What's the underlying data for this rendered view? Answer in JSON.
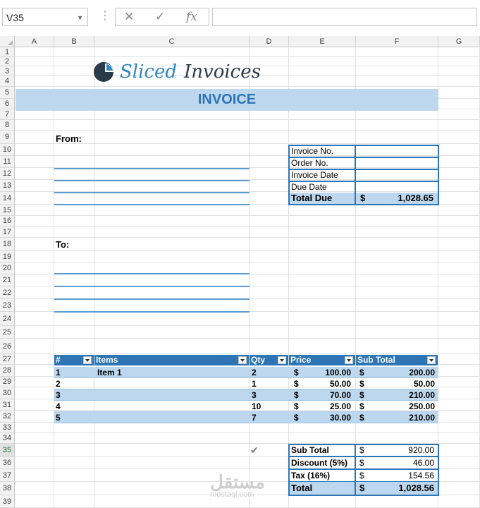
{
  "namebox": {
    "value": "V35"
  },
  "formula_bar": {
    "value": ""
  },
  "columns": [
    "A",
    "B",
    "C",
    "D",
    "E",
    "F",
    "G"
  ],
  "rows": [
    "1",
    "2",
    "3",
    "4",
    "5",
    "6",
    "7",
    "8",
    "9",
    "10",
    "11",
    "12",
    "13",
    "14",
    "15",
    "16",
    "17",
    "18",
    "19",
    "20",
    "21",
    "22",
    "23",
    "24",
    "25",
    "26",
    "27",
    "28",
    "29",
    "30",
    "31",
    "32",
    "33",
    "34",
    "35",
    "36",
    "37",
    "38",
    "39"
  ],
  "selected_row": "35",
  "logo": {
    "part1": "Sliced",
    "part2": "Invoices"
  },
  "invoice": {
    "title": "INVOICE",
    "from_label": "From:",
    "to_label": "To:",
    "info_rows": [
      {
        "label": "Invoice No.",
        "value": ""
      },
      {
        "label": "Order No.",
        "value": ""
      },
      {
        "label": "Invoice Date",
        "value": ""
      },
      {
        "label": "Due Date",
        "value": ""
      }
    ],
    "total_due": {
      "label": "Total Due",
      "currency": "$",
      "value": "1,028.65"
    }
  },
  "items_table": {
    "headers": [
      "#",
      "Items",
      "Qty",
      "Price",
      "Sub Total"
    ],
    "rows": [
      {
        "num": "1",
        "item": "Item 1",
        "qty": "2",
        "price_cur": "$",
        "price": "100.00",
        "sub_cur": "$",
        "sub": "200.00"
      },
      {
        "num": "2",
        "item": "",
        "qty": "1",
        "price_cur": "$",
        "price": "50.00",
        "sub_cur": "$",
        "sub": "50.00"
      },
      {
        "num": "3",
        "item": "",
        "qty": "3",
        "price_cur": "$",
        "price": "70.00",
        "sub_cur": "$",
        "sub": "210.00"
      },
      {
        "num": "4",
        "item": "",
        "qty": "10",
        "price_cur": "$",
        "price": "25.00",
        "sub_cur": "$",
        "sub": "250.00"
      },
      {
        "num": "5",
        "item": "",
        "qty": "7",
        "price_cur": "$",
        "price": "30.00",
        "sub_cur": "$",
        "sub": "210.00"
      }
    ]
  },
  "totals": [
    {
      "label": "Sub Total",
      "currency": "$",
      "value": "920.00"
    },
    {
      "label": "Discount (5%)",
      "currency": "$",
      "value": "46.00"
    },
    {
      "label": "Tax (16%)",
      "currency": "$",
      "value": "154.56"
    },
    {
      "label": "Total",
      "currency": "$",
      "value": "1,028.56"
    }
  ],
  "watermark": {
    "arabic": "مستقل",
    "latin": "mostaql.com"
  },
  "colors": {
    "accent": "#2e75b6",
    "band": "#bdd7ee",
    "logo_dark": "#2b3a4a",
    "logo_blue": "#2e86c1"
  }
}
